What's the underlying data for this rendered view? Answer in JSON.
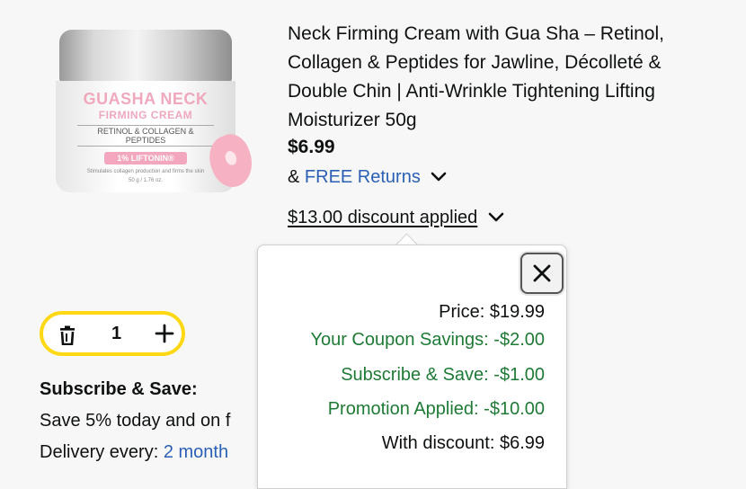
{
  "product": {
    "image": {
      "brand_line1": "GUASHA NECK",
      "brand_line2": "FIRMING CREAM",
      "ingredients": "RETINOL & COLLAGEN & PEPTIDES",
      "badge": "1% LIFTONIN®",
      "tagline": "Stimulates collagen production and firms the skin",
      "size": "50 g / 1.76 oz."
    },
    "title": "Neck Firming Cream with Gua Sha – Retinol, Collagen & Peptides for Jawline, Décolleté & Double Chin | Anti-Wrinkle Tightening Lifting Moisturizer 50g",
    "price": "$6.99",
    "returns_prefix": "&",
    "returns_link": "FREE Returns",
    "discount_text": "$13.00 discount applied"
  },
  "popover": {
    "price_label": "Price: $19.99",
    "coupon": "Your Coupon Savings: -$2.00",
    "subscribe": "Subscribe & Save: -$1.00",
    "promotion": "Promotion Applied: -$10.00",
    "with_discount": "With discount: $6.99"
  },
  "quantity": {
    "value": "1"
  },
  "subscribe": {
    "title": "Subscribe & Save:",
    "save_text": "Save 5% today and on f",
    "delivery_label": "Delivery every: ",
    "delivery_value": "2 month"
  },
  "colors": {
    "link": "#2a5fb5",
    "savings_green": "#1f7a36",
    "qty_border": "#ffd814"
  }
}
